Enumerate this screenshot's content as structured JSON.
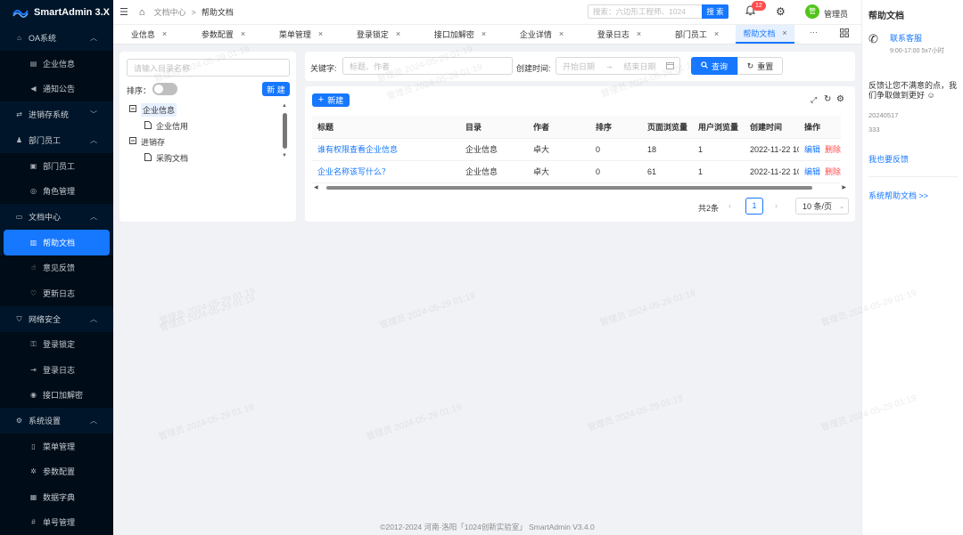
{
  "app": {
    "title": "SmartAdmin 3.X"
  },
  "sidebar": [
    {
      "type": "group",
      "label": "OA系统",
      "icon": "bank-icon",
      "open": true
    },
    {
      "type": "item",
      "label": "企业信息",
      "icon": "building-icon"
    },
    {
      "type": "item",
      "label": "通知公告",
      "icon": "sound-icon"
    },
    {
      "type": "group",
      "label": "进销存系统",
      "icon": "swap-icon",
      "open": false
    },
    {
      "type": "group",
      "label": "部门员工",
      "icon": "user-icon",
      "open": true
    },
    {
      "type": "item",
      "label": "部门员工",
      "icon": "team-icon"
    },
    {
      "type": "item",
      "label": "角色管理",
      "icon": "role-icon"
    },
    {
      "type": "group",
      "label": "文档中心",
      "icon": "doc-icon",
      "open": true
    },
    {
      "type": "item",
      "label": "帮助文档",
      "icon": "book-icon",
      "active": true
    },
    {
      "type": "item",
      "label": "意见反馈",
      "icon": "like-icon"
    },
    {
      "type": "item",
      "label": "更新日志",
      "icon": "heart-icon"
    },
    {
      "type": "group",
      "label": "网络安全",
      "icon": "shield-icon",
      "open": true
    },
    {
      "type": "item",
      "label": "登录锁定",
      "icon": "lock-icon"
    },
    {
      "type": "item",
      "label": "登录日志",
      "icon": "login-icon"
    },
    {
      "type": "item",
      "label": "接口加解密",
      "icon": "api-icon"
    },
    {
      "type": "group",
      "label": "系统设置",
      "icon": "gear-icon",
      "open": true
    },
    {
      "type": "item",
      "label": "菜单管理",
      "icon": "menu-icon"
    },
    {
      "type": "item",
      "label": "参数配置",
      "icon": "config-icon"
    },
    {
      "type": "item",
      "label": "数据字典",
      "icon": "dict-icon"
    },
    {
      "type": "item",
      "label": "单号管理",
      "icon": "hash-icon"
    }
  ],
  "header": {
    "breadcrumb": [
      "文档中心",
      "帮助文档"
    ],
    "breadcrumb_sep": ">",
    "search_placeholder": "搜索：六边形工程师、1024",
    "search_button": "搜 索",
    "notification_count": "12",
    "user_avatar": "管",
    "user_name": "管理员"
  },
  "tabs": [
    {
      "label": "业信息"
    },
    {
      "label": "参数配置"
    },
    {
      "label": "菜单管理"
    },
    {
      "label": "登录锁定"
    },
    {
      "label": "接口加解密"
    },
    {
      "label": "企业详情"
    },
    {
      "label": "登录日志"
    },
    {
      "label": "部门员工"
    },
    {
      "label": "帮助文档",
      "active": true
    }
  ],
  "tabs_more": "···",
  "left_panel": {
    "search_placeholder": "请输入目录名称",
    "sort_label": "排序：",
    "new_button": "新 建",
    "tree": [
      {
        "label": "企业信息",
        "level": 0,
        "expanded": true,
        "selected": true
      },
      {
        "label": "企业信用",
        "level": 1
      },
      {
        "label": "进销存",
        "level": 0,
        "expanded": true
      },
      {
        "label": "采购文档",
        "level": 1
      }
    ]
  },
  "filter": {
    "keyword_label": "关键字:",
    "keyword_placeholder": "标题、作者",
    "date_label": "创建时间:",
    "start_placeholder": "开始日期",
    "end_placeholder": "结束日期",
    "date_sep": "→",
    "query_button": "查询",
    "reset_button": "重置"
  },
  "table": {
    "new_button": "新建",
    "columns": [
      "标题",
      "目录",
      "作者",
      "排序",
      "页面浏览量",
      "用户浏览量",
      "创建时间",
      "操作"
    ],
    "rows": [
      {
        "title": "谁有权限查看企业信息",
        "catalog": "企业信息",
        "author": "卓大",
        "sort": "0",
        "pv": "18",
        "uv": "1",
        "created": "2022-11-22 10",
        "edit": "编辑",
        "delete": "删除"
      },
      {
        "title": "企业名称该写什么？",
        "catalog": "企业信息",
        "author": "卓大",
        "sort": "0",
        "pv": "61",
        "uv": "1",
        "created": "2022-11-22 10",
        "edit": "编辑",
        "delete": "删除"
      }
    ]
  },
  "pagination": {
    "total_text": "共2条",
    "current_page": "1",
    "page_size": "10 条/页"
  },
  "right_panel": {
    "title": "帮助文档",
    "contact_title": "联系客服",
    "contact_hours": "9:00-17:00 5x7小时",
    "feedback_text": "反馈让您不满意的点，我们争取做到更好",
    "date": "20240517",
    "count": "333",
    "feedback_link": "我也要反馈",
    "system_link": "系统帮助文档 >>"
  },
  "footer": {
    "text": "©2012-2024 河南·洛阳「1024创新实验室」 SmartAdmin V3.4.0"
  },
  "watermark": {
    "text": "管理员 2024-05-29 01:19"
  },
  "colors": {
    "primary": "#1677ff",
    "danger": "#ff4d4f",
    "sidebar": "#001529"
  }
}
